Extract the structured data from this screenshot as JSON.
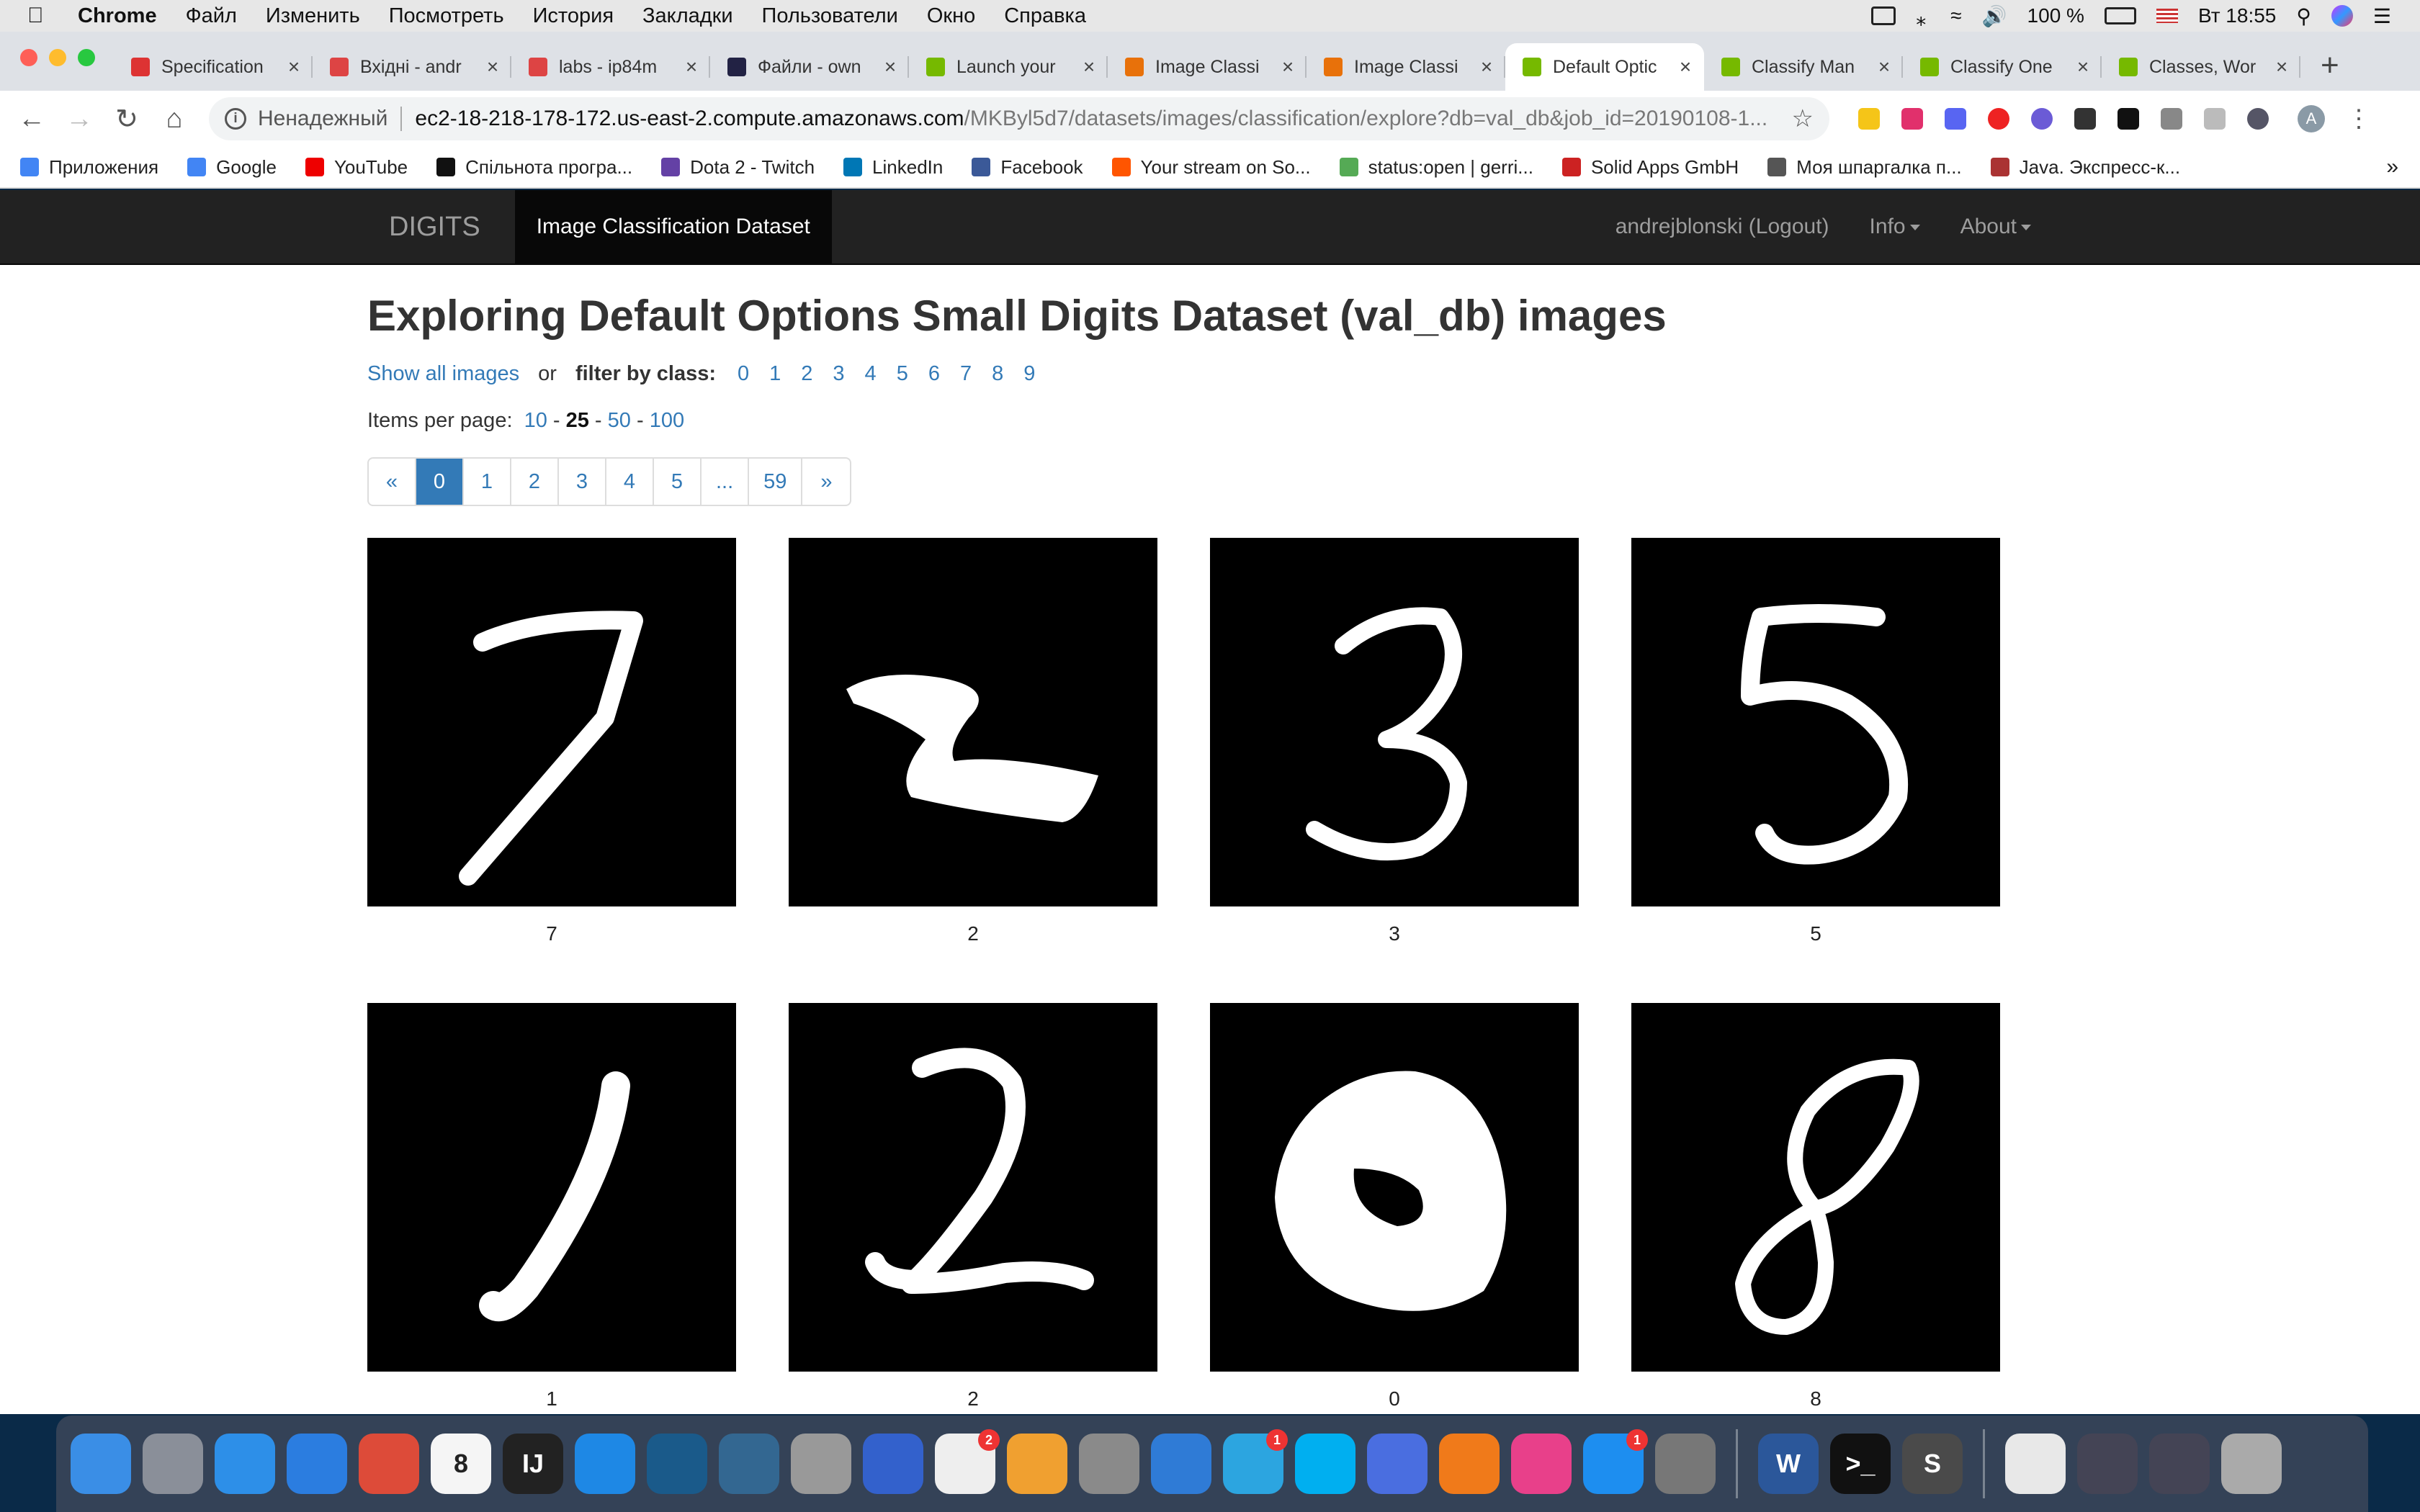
{
  "menubar": {
    "app_name": "Chrome",
    "items": [
      "Файл",
      "Изменить",
      "Посмотреть",
      "История",
      "Закладки",
      "Пользователи",
      "Окно",
      "Справка"
    ],
    "battery": "100 %",
    "clock": "Вт 18:55"
  },
  "tabs": [
    {
      "title": "Specification",
      "color": "#d33"
    },
    {
      "title": "Вхідні - andr",
      "color": "#d44"
    },
    {
      "title": "labs - ip84m",
      "color": "#d44"
    },
    {
      "title": "Файли - own",
      "color": "#224"
    },
    {
      "title": "Launch your",
      "color": "#76b900"
    },
    {
      "title": "Image Classi",
      "color": "#e8710a"
    },
    {
      "title": "Image Classi",
      "color": "#e8710a"
    },
    {
      "title": "Default Optic",
      "color": "#76b900"
    },
    {
      "title": "Classify Man",
      "color": "#76b900"
    },
    {
      "title": "Classify One",
      "color": "#76b900"
    },
    {
      "title": "Classes, Wor",
      "color": "#76b900"
    }
  ],
  "address": {
    "security_label": "Ненадежный",
    "host": "ec2-18-218-178-172.us-east-2.compute.amazonaws.com",
    "path": "/MKByl5d7/datasets/images/classification/explore?db=val_db&job_id=20190108-1..."
  },
  "bookmarks": [
    {
      "label": "Приложения",
      "color": "#4285f4"
    },
    {
      "label": "Google",
      "color": "#4285f4"
    },
    {
      "label": "YouTube",
      "color": "#e00"
    },
    {
      "label": "Спільнота програ...",
      "color": "#111"
    },
    {
      "label": "Dota 2 - Twitch",
      "color": "#6441a5"
    },
    {
      "label": "LinkedIn",
      "color": "#0077b5"
    },
    {
      "label": "Facebook",
      "color": "#3b5998"
    },
    {
      "label": "Your stream on So...",
      "color": "#f50"
    },
    {
      "label": "status:open | gerri...",
      "color": "#5a5"
    },
    {
      "label": "Solid Apps GmbH",
      "color": "#c22"
    },
    {
      "label": "Моя шпаргалка п...",
      "color": "#555"
    },
    {
      "label": "Java. Экспресс-к...",
      "color": "#a33"
    }
  ],
  "navbar": {
    "brand": "DIGITS",
    "active": "Image Classification Dataset",
    "user": "andrejblonski (Logout)",
    "info": "Info",
    "about": "About"
  },
  "page": {
    "title": "Exploring Default Options Small Digits Dataset (val_db) images",
    "show_all": "Show all images",
    "or": "or",
    "filter_label": "filter by class:",
    "classes": [
      "0",
      "1",
      "2",
      "3",
      "4",
      "5",
      "6",
      "7",
      "8",
      "9"
    ],
    "per_page_label": "Items per page:",
    "per_page_options": [
      "10",
      "25",
      "50",
      "100"
    ],
    "per_page_selected": "25",
    "pagination": [
      "«",
      "0",
      "1",
      "2",
      "3",
      "4",
      "5",
      "...",
      "59",
      "»"
    ],
    "current_page": "0"
  },
  "images": [
    {
      "label": "7",
      "glyph": "7"
    },
    {
      "label": "2",
      "glyph": "2"
    },
    {
      "label": "3",
      "glyph": "3"
    },
    {
      "label": "5",
      "glyph": "5"
    },
    {
      "label": "1",
      "glyph": "1"
    },
    {
      "label": "2",
      "glyph": "2"
    },
    {
      "label": "0",
      "glyph": "0"
    },
    {
      "label": "8",
      "glyph": "8"
    }
  ],
  "dock": [
    {
      "name": "finder",
      "color": "#3a8ee6"
    },
    {
      "name": "launchpad",
      "color": "#8a8f99"
    },
    {
      "name": "safari",
      "color": "#2d8fe8"
    },
    {
      "name": "spark",
      "color": "#2b7de0"
    },
    {
      "name": "chrome",
      "color": "#dd4b39"
    },
    {
      "name": "calendar",
      "color": "#f5f5f5",
      "text": "8"
    },
    {
      "name": "intellij",
      "color": "#222",
      "text": "IJ"
    },
    {
      "name": "xcode",
      "color": "#1e88e5"
    },
    {
      "name": "mysql-workbench",
      "color": "#1a5a8a"
    },
    {
      "name": "postgres",
      "color": "#336791"
    },
    {
      "name": "sequel",
      "color": "#999"
    },
    {
      "name": "simplenote",
      "color": "#3361cc"
    },
    {
      "name": "reminders",
      "color": "#eee",
      "badge": "2"
    },
    {
      "name": "photos",
      "color": "#f0a030"
    },
    {
      "name": "numbers",
      "color": "#8a8a8a"
    },
    {
      "name": "keynote",
      "color": "#2f7bd6"
    },
    {
      "name": "telegram",
      "color": "#2ca5e0",
      "badge": "1"
    },
    {
      "name": "skype",
      "color": "#00aff0"
    },
    {
      "name": "tweetbot",
      "color": "#4a6ee0"
    },
    {
      "name": "kindle",
      "color": "#f07a1a"
    },
    {
      "name": "itunes",
      "color": "#e8408a"
    },
    {
      "name": "app-store",
      "color": "#1d8ef0",
      "badge": "1"
    },
    {
      "name": "system-preferences",
      "color": "#777"
    },
    {
      "name": "word",
      "color": "#2b579a",
      "text": "W"
    },
    {
      "name": "terminal",
      "color": "#111",
      "text": ">_"
    },
    {
      "name": "sublime",
      "color": "#4a4a4a",
      "text": "S"
    },
    {
      "name": "documents",
      "color": "#e8e8e8"
    },
    {
      "name": "downloads-stack",
      "color": "#445"
    },
    {
      "name": "screenshots-stack",
      "color": "#445"
    },
    {
      "name": "trash",
      "color": "#aaa"
    }
  ]
}
